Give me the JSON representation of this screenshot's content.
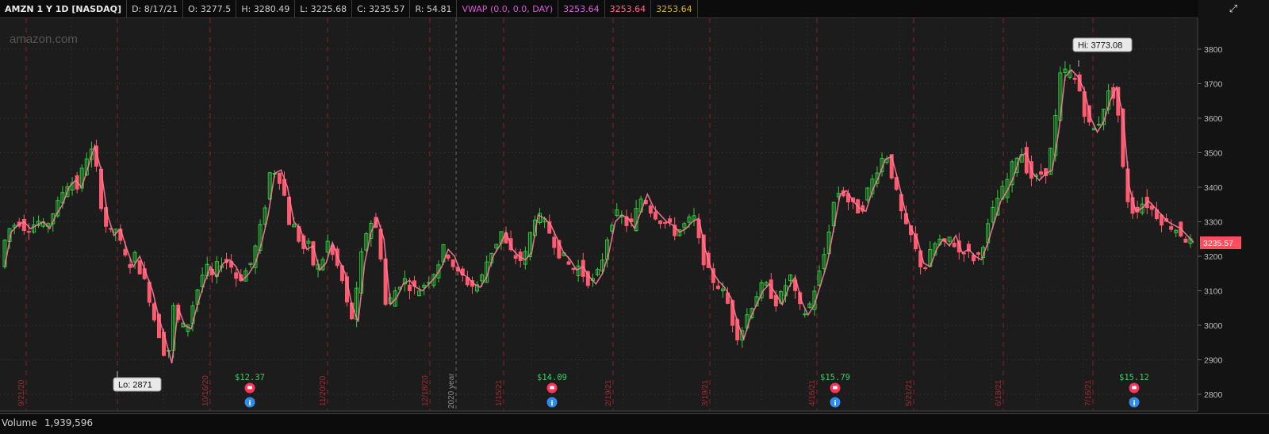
{
  "header": {
    "symbol": "AMZN 1 Y 1D [NASDAQ]",
    "date": "D: 8/17/21",
    "open": "O: 3277.5",
    "high": "H: 3280.49",
    "low": "L: 3225.68",
    "close": "C: 3235.57",
    "range": "R: 54.81",
    "vwap_label": "VWAP (0.0, 0.0, DAY)",
    "vwap_values": [
      "3253.64",
      "3253.64",
      "3253.64"
    ]
  },
  "watermark": "amazon.com",
  "volume": {
    "label": "Volume",
    "value": "1,939,596"
  },
  "colors": {
    "up": "#2ecc3a",
    "down": "#ff5a6e",
    "price_line": "#ff7fa0",
    "earnings": "#ff3355",
    "dividend_text": "#38d05a",
    "event_blue": "#2d8cf0"
  },
  "chart_data": {
    "type": "candlestick",
    "ylim": [
      2760,
      3850
    ],
    "y_ticks": [
      2800,
      2900,
      3000,
      3100,
      3200,
      3300,
      3400,
      3500,
      3600,
      3700,
      3800
    ],
    "last_price": "3235.57",
    "high_label": "Hi: 3773.08",
    "low_label": "Lo: 2871",
    "period_separators": [
      {
        "label": "9/21/20"
      },
      {
        "label": "10/16/20"
      },
      {
        "label": "11/20/20"
      },
      {
        "label": "12/18/20"
      },
      {
        "label": "2020 year"
      },
      {
        "label": "1/15/21"
      },
      {
        "label": "2/19/21"
      },
      {
        "label": "3/19/21"
      },
      {
        "label": "4/16/21"
      },
      {
        "label": "5/21/21"
      },
      {
        "label": "6/18/21"
      },
      {
        "label": "7/16/21"
      }
    ],
    "events": [
      {
        "label": "$12.37"
      },
      {
        "label": "$14.09"
      },
      {
        "label": "$15.79"
      },
      {
        "label": "$15.12"
      }
    ],
    "price_path": [
      [
        0,
        3170
      ],
      [
        4,
        3270
      ],
      [
        8,
        3290
      ],
      [
        12,
        3300
      ],
      [
        16,
        3280
      ],
      [
        20,
        3290
      ],
      [
        24,
        3300
      ],
      [
        28,
        3280
      ],
      [
        32,
        3320
      ],
      [
        36,
        3350
      ],
      [
        40,
        3400
      ],
      [
        44,
        3420
      ],
      [
        48,
        3400
      ],
      [
        52,
        3460
      ],
      [
        56,
        3520
      ],
      [
        60,
        3450
      ],
      [
        64,
        3320
      ],
      [
        68,
        3260
      ],
      [
        72,
        3280
      ],
      [
        76,
        3220
      ],
      [
        80,
        3170
      ],
      [
        84,
        3200
      ],
      [
        88,
        3150
      ],
      [
        92,
        3100
      ],
      [
        96,
        3020
      ],
      [
        100,
        2960
      ],
      [
        104,
        2890
      ],
      [
        108,
        3050
      ],
      [
        112,
        3000
      ],
      [
        116,
        2990
      ],
      [
        120,
        3060
      ],
      [
        124,
        3120
      ],
      [
        128,
        3170
      ],
      [
        132,
        3140
      ],
      [
        136,
        3180
      ],
      [
        140,
        3190
      ],
      [
        144,
        3170
      ],
      [
        148,
        3130
      ],
      [
        152,
        3150
      ],
      [
        156,
        3180
      ],
      [
        160,
        3240
      ],
      [
        164,
        3320
      ],
      [
        168,
        3440
      ],
      [
        172,
        3450
      ],
      [
        176,
        3400
      ],
      [
        180,
        3300
      ],
      [
        184,
        3280
      ],
      [
        188,
        3220
      ],
      [
        192,
        3230
      ],
      [
        196,
        3160
      ],
      [
        200,
        3180
      ],
      [
        204,
        3240
      ],
      [
        208,
        3190
      ],
      [
        212,
        3150
      ],
      [
        216,
        3060
      ],
      [
        220,
        3010
      ],
      [
        224,
        3180
      ],
      [
        228,
        3270
      ],
      [
        232,
        3310
      ],
      [
        236,
        3250
      ],
      [
        240,
        3060
      ],
      [
        244,
        3080
      ],
      [
        248,
        3120
      ],
      [
        252,
        3130
      ],
      [
        256,
        3110
      ],
      [
        260,
        3100
      ],
      [
        264,
        3120
      ],
      [
        268,
        3140
      ],
      [
        272,
        3170
      ],
      [
        276,
        3220
      ],
      [
        280,
        3200
      ],
      [
        284,
        3150
      ],
      [
        288,
        3140
      ],
      [
        292,
        3120
      ],
      [
        296,
        3110
      ],
      [
        300,
        3140
      ],
      [
        304,
        3200
      ],
      [
        308,
        3230
      ],
      [
        312,
        3270
      ],
      [
        316,
        3220
      ],
      [
        320,
        3200
      ],
      [
        324,
        3190
      ],
      [
        328,
        3210
      ],
      [
        332,
        3320
      ],
      [
        336,
        3310
      ],
      [
        340,
        3290
      ],
      [
        344,
        3250
      ],
      [
        348,
        3210
      ],
      [
        352,
        3190
      ],
      [
        356,
        3160
      ],
      [
        360,
        3170
      ],
      [
        364,
        3140
      ],
      [
        368,
        3120
      ],
      [
        372,
        3150
      ],
      [
        376,
        3210
      ],
      [
        380,
        3300
      ],
      [
        384,
        3320
      ],
      [
        388,
        3310
      ],
      [
        392,
        3280
      ],
      [
        396,
        3330
      ],
      [
        400,
        3380
      ],
      [
        404,
        3340
      ],
      [
        408,
        3320
      ],
      [
        412,
        3300
      ],
      [
        416,
        3290
      ],
      [
        420,
        3270
      ],
      [
        424,
        3280
      ],
      [
        428,
        3300
      ],
      [
        432,
        3310
      ],
      [
        436,
        3220
      ],
      [
        440,
        3160
      ],
      [
        444,
        3130
      ],
      [
        448,
        3110
      ],
      [
        452,
        3080
      ],
      [
        456,
        3010
      ],
      [
        460,
        2960
      ],
      [
        464,
        3020
      ],
      [
        468,
        3060
      ],
      [
        472,
        3100
      ],
      [
        476,
        3120
      ],
      [
        480,
        3090
      ],
      [
        484,
        3060
      ],
      [
        488,
        3110
      ],
      [
        492,
        3140
      ],
      [
        496,
        3070
      ],
      [
        500,
        3030
      ],
      [
        504,
        3060
      ],
      [
        508,
        3120
      ],
      [
        512,
        3180
      ],
      [
        516,
        3280
      ],
      [
        520,
        3380
      ],
      [
        524,
        3390
      ],
      [
        528,
        3360
      ],
      [
        532,
        3340
      ],
      [
        536,
        3330
      ],
      [
        540,
        3390
      ],
      [
        544,
        3430
      ],
      [
        548,
        3480
      ],
      [
        552,
        3490
      ],
      [
        556,
        3420
      ],
      [
        560,
        3340
      ],
      [
        564,
        3280
      ],
      [
        568,
        3250
      ],
      [
        572,
        3180
      ],
      [
        576,
        3170
      ],
      [
        580,
        3220
      ],
      [
        584,
        3250
      ],
      [
        588,
        3230
      ],
      [
        592,
        3260
      ],
      [
        596,
        3210
      ],
      [
        600,
        3220
      ],
      [
        604,
        3200
      ],
      [
        608,
        3190
      ],
      [
        612,
        3240
      ],
      [
        616,
        3300
      ],
      [
        620,
        3360
      ],
      [
        624,
        3390
      ],
      [
        628,
        3430
      ],
      [
        632,
        3490
      ],
      [
        636,
        3500
      ],
      [
        640,
        3440
      ],
      [
        644,
        3420
      ],
      [
        648,
        3440
      ],
      [
        652,
        3450
      ],
      [
        656,
        3560
      ],
      [
        660,
        3720
      ],
      [
        664,
        3740
      ],
      [
        668,
        3720
      ],
      [
        672,
        3680
      ],
      [
        676,
        3600
      ],
      [
        680,
        3560
      ],
      [
        684,
        3590
      ],
      [
        688,
        3650
      ],
      [
        692,
        3690
      ],
      [
        696,
        3610
      ],
      [
        700,
        3400
      ],
      [
        704,
        3330
      ],
      [
        708,
        3340
      ],
      [
        712,
        3360
      ],
      [
        716,
        3340
      ],
      [
        720,
        3320
      ],
      [
        724,
        3300
      ],
      [
        728,
        3290
      ],
      [
        732,
        3280
      ],
      [
        736,
        3260
      ],
      [
        740,
        3240
      ]
    ]
  }
}
